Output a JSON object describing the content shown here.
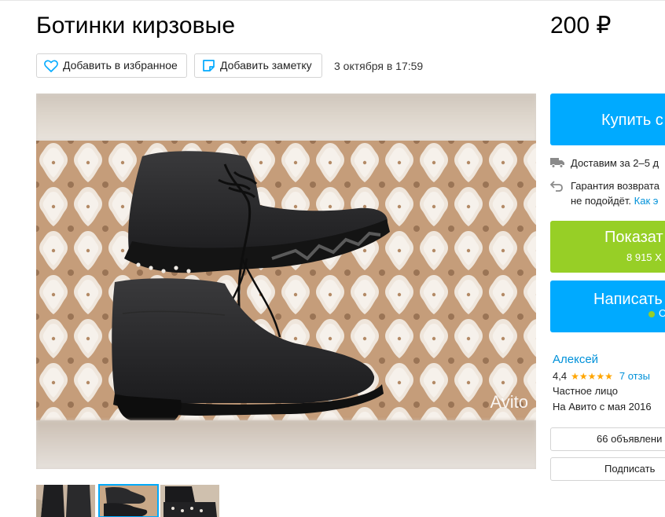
{
  "listing": {
    "title": "Ботинки кирзовые",
    "price": "200 ₽",
    "date": "3 октября в 17:59"
  },
  "actions": {
    "favorite_label": "Добавить в избранное",
    "note_label": "Добавить заметку"
  },
  "gallery": {
    "watermark": "Avito",
    "thumbnails": [
      "photo-1",
      "photo-2",
      "photo-3"
    ],
    "selected_index": 1
  },
  "sidebar": {
    "buy_label": "Купить с",
    "delivery_text": "Доставим за 2–5 д",
    "guarantee_line1": "Гарантия возврата",
    "guarantee_line2": "не подойдёт.",
    "guarantee_link": "Как э",
    "phone_label": "Показат",
    "phone_number": "8 915 Х",
    "message_label": "Написать",
    "online_status": "О"
  },
  "seller": {
    "name": "Алексей",
    "rating": "4,4",
    "stars_filled": 4.5,
    "stars_glyphs": "★★★★★",
    "reviews": "7 отзы",
    "type": "Частное лицо",
    "since": "На Авито с мая 2016",
    "ads_button": "66 объявлени",
    "subscribe_button": "Подписать"
  },
  "colors": {
    "accent_blue": "#00aaff",
    "accent_green": "#97cf26",
    "link_blue": "#0091d9",
    "star": "#ffa500"
  }
}
